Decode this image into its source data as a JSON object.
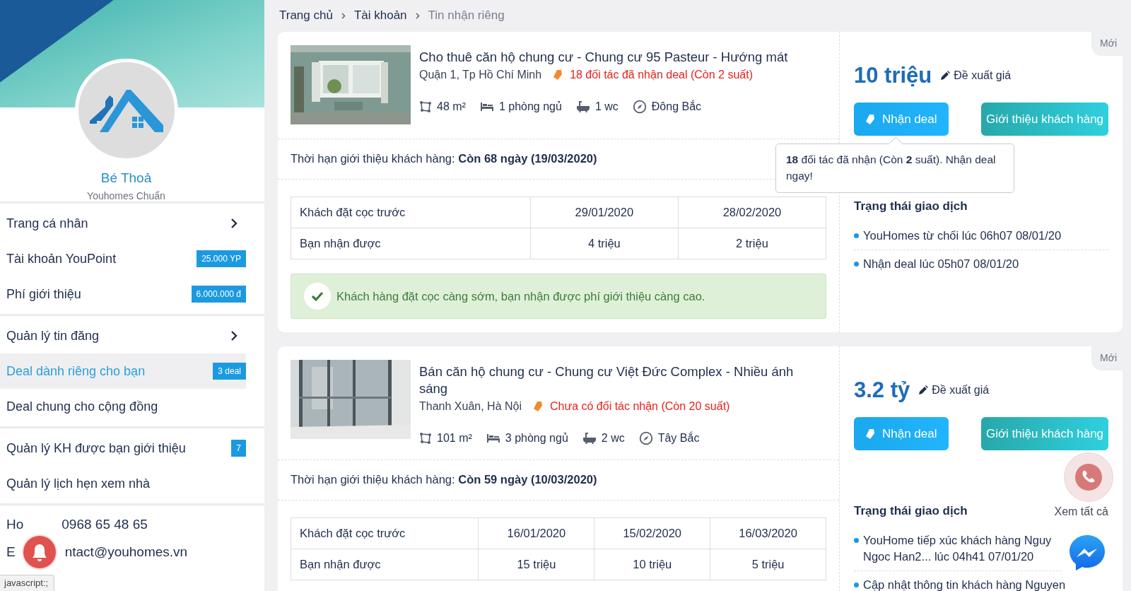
{
  "sidebar": {
    "user": {
      "name": "Bé Thoả",
      "rank": "Youhomes Chuẩn"
    },
    "menu_groups": [
      [
        {
          "label": "Trang cá nhân",
          "kind": "arrow",
          "selected": false
        },
        {
          "label": "Tài khoản YouPoint",
          "kind": "badge",
          "badge": "25.000 YP",
          "selected": false
        },
        {
          "label": "Phí giới thiệu",
          "kind": "badge",
          "badge": "6.000.000 đ",
          "selected": false
        }
      ],
      [
        {
          "label": "Quản lý tin đăng",
          "kind": "arrow",
          "selected": false
        },
        {
          "label": "Deal dành riêng cho bạn",
          "kind": "badge",
          "badge": "3 deal",
          "selected": true
        },
        {
          "label": "Deal chung cho cộng đồng",
          "kind": "plain",
          "selected": false
        }
      ],
      [
        {
          "label": "Quản lý KH được bạn giới thiệu",
          "kind": "badge",
          "badge": "7",
          "selected": false
        },
        {
          "label": "Quản lý lịch hẹn xem nhà",
          "kind": "plain",
          "selected": false
        }
      ]
    ],
    "contacts": [
      {
        "label": "Ho",
        "value": "0968 65 48 65"
      },
      {
        "label": "E",
        "value": "ntact@youhomes.vn"
      }
    ]
  },
  "breadcrumb": [
    {
      "label": "Trang chủ",
      "current": false
    },
    {
      "label": "Tài khoản",
      "current": false
    },
    {
      "label": "Tin nhận riêng",
      "current": true
    }
  ],
  "deals": [
    {
      "title": "Cho thuê căn hộ chung cư - Chung cư 95 Pasteur - Hướng mát",
      "location": "Quận 1, Tp Hồ Chí Minh",
      "partners_note": "18 đối tác đã nhận deal (Còn 2 suất)",
      "features": [
        {
          "kind": "area",
          "text": "48 m²"
        },
        {
          "kind": "bedroom",
          "text": "1 phòng ngủ"
        },
        {
          "kind": "bathroom",
          "text": "1 wc"
        },
        {
          "kind": "direction",
          "text": "Đông Bắc"
        }
      ],
      "deadline": {
        "label": "Thời hạn giới thiệu khách hàng:",
        "value": "Còn 68 ngày (19/03/2020)"
      },
      "table": [
        [
          "Khách đặt cọc trước",
          "29/01/2020",
          "28/02/2020"
        ],
        [
          "Bạn nhận được",
          "4 triệu",
          "2 triệu"
        ]
      ],
      "notice": "Khách hàng đặt cọc càng sớm, bạn nhận được phí giới thiệu càng cao.",
      "badge": "Mới",
      "price": "10 triệu",
      "propose": "Đề xuất giá",
      "deal_button": "Nhận deal",
      "refer_button": "Giới thiệu khách hàng",
      "tooltip": "**18** đối tác đã nhận (Còn **2** suất). Nhận deal ngay!",
      "status": {
        "title": "Trạng thái giao dịch",
        "items": [
          {
            "lines": [
              "YouHomes từ chối lúc 06h07 08/01/20"
            ]
          },
          {
            "lines": [
              "Nhận deal lúc 05h07 08/01/20"
            ]
          }
        ]
      }
    },
    {
      "title": "Bán căn hộ chung cư - Chung cư Việt Đức Complex - Nhiều ánh sáng",
      "location": "Thanh Xuân, Hà Nội",
      "partners_note": "Chưa có đối tác nhận (Còn 20 suất)",
      "features": [
        {
          "kind": "area",
          "text": "101 m²"
        },
        {
          "kind": "bedroom",
          "text": "3 phòng ngủ"
        },
        {
          "kind": "bathroom",
          "text": "2 wc"
        },
        {
          "kind": "direction",
          "text": "Tây Bắc"
        }
      ],
      "deadline": {
        "label": "Thời hạn giới thiệu khách hàng:",
        "value": "Còn 59 ngày (10/03/2020)"
      },
      "table": [
        [
          "Khách đặt cọc trước",
          "16/01/2020",
          "15/02/2020",
          "16/03/2020"
        ],
        [
          "Bạn nhận được",
          "15 triệu",
          "10 triệu",
          "5 triệu"
        ]
      ],
      "badge": "Mới",
      "price": "3.2 tỷ",
      "propose": "Đề xuất giá",
      "deal_button": "Nhận deal",
      "refer_button": "Giới thiệu khách hàng",
      "status": {
        "title": "Trạng thái giao dịch",
        "view_all": "Xem tất cả",
        "items": [
          {
            "lines": [
              "YouHome tiếp xúc khách hàng Nguy",
              "Ngoc Han2... lúc 04h41 07/01/20"
            ]
          },
          {
            "lines": [
              "Cập nhật thông tin khách hàng Nguyen"
            ]
          }
        ]
      }
    }
  ],
  "status_bar": "javascript:;"
}
